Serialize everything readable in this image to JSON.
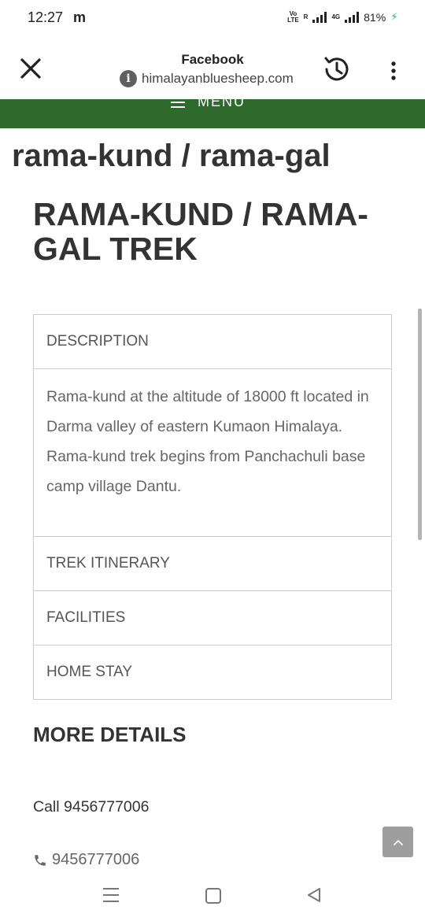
{
  "status_bar": {
    "time": "12:27",
    "app_icon": "m",
    "volte_top": "Vo",
    "volte_bottom": "LTE",
    "roaming": "R",
    "network": "4G",
    "battery": "81%"
  },
  "browser": {
    "title": "Facebook",
    "url": "himalayanbluesheep.com"
  },
  "menu": {
    "label": "MENU"
  },
  "page": {
    "site_heading": "rama-kund / rama-gal",
    "trek_title": "RAMA-KUND / RAMA-GAL TREK",
    "accordion": [
      {
        "label": "DESCRIPTION",
        "expanded": true,
        "body": "Rama-kund at the altitude of 18000 ft located in Darma valley of eastern Kumaon Himalaya. Rama-kund  trek begins from Panchachuli base camp village Dantu."
      },
      {
        "label": "TREK ITINERARY",
        "expanded": false
      },
      {
        "label": "FACILITIES",
        "expanded": false
      },
      {
        "label": "HOME STAY",
        "expanded": false
      }
    ],
    "more_details": "MORE DETAILS",
    "call_text": "Call 9456777006",
    "phone": "9456777006"
  },
  "colors": {
    "menu_bar": "#2d6a2c",
    "back_to_top": "#9e9e9e",
    "battery_bolt": "#3dbb6c"
  },
  "icons": [
    "close-icon",
    "info-icon",
    "history-icon",
    "more-options-icon",
    "hamburger-icon",
    "phone-icon",
    "chevron-up-icon"
  ]
}
